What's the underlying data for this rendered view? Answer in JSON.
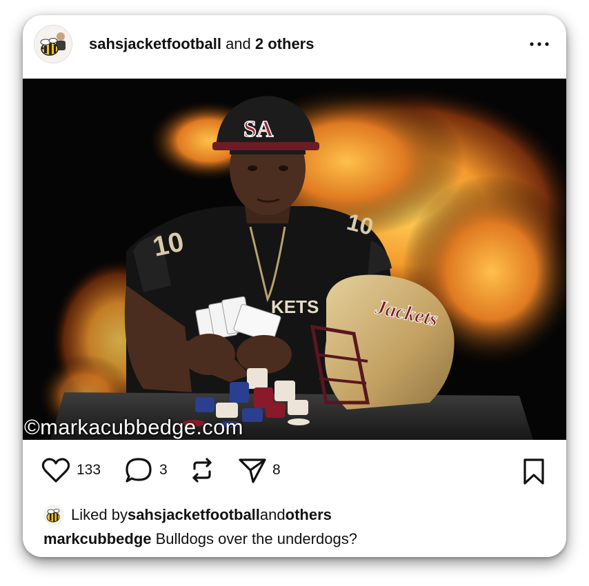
{
  "post": {
    "header": {
      "username": "sahsjacketfootball",
      "joiner": " and ",
      "others": "2 others"
    },
    "image": {
      "watermark": "©markacubbedge.com",
      "jersey_number": "10",
      "helmet_text": "Jackets",
      "jersey_text": "KETS"
    },
    "actions": {
      "likes": "133",
      "comments": "3",
      "shares": "8"
    },
    "liked_by": {
      "prefix": "Liked by ",
      "user": "sahsjacketfootball",
      "joiner": " and ",
      "others": "others"
    },
    "caption": {
      "user": "markcubbedge",
      "text": " Bulldogs over the underdogs?"
    }
  },
  "icons": [
    "bee-mascot-icon",
    "more-options-icon",
    "heart-icon",
    "comment-icon",
    "repost-icon",
    "share-icon",
    "bookmark-icon"
  ],
  "colors": {
    "fire": "#f29a2e",
    "helmet_gold": "#c9a869",
    "maroon": "#7a1f2b",
    "text": "#111111"
  }
}
